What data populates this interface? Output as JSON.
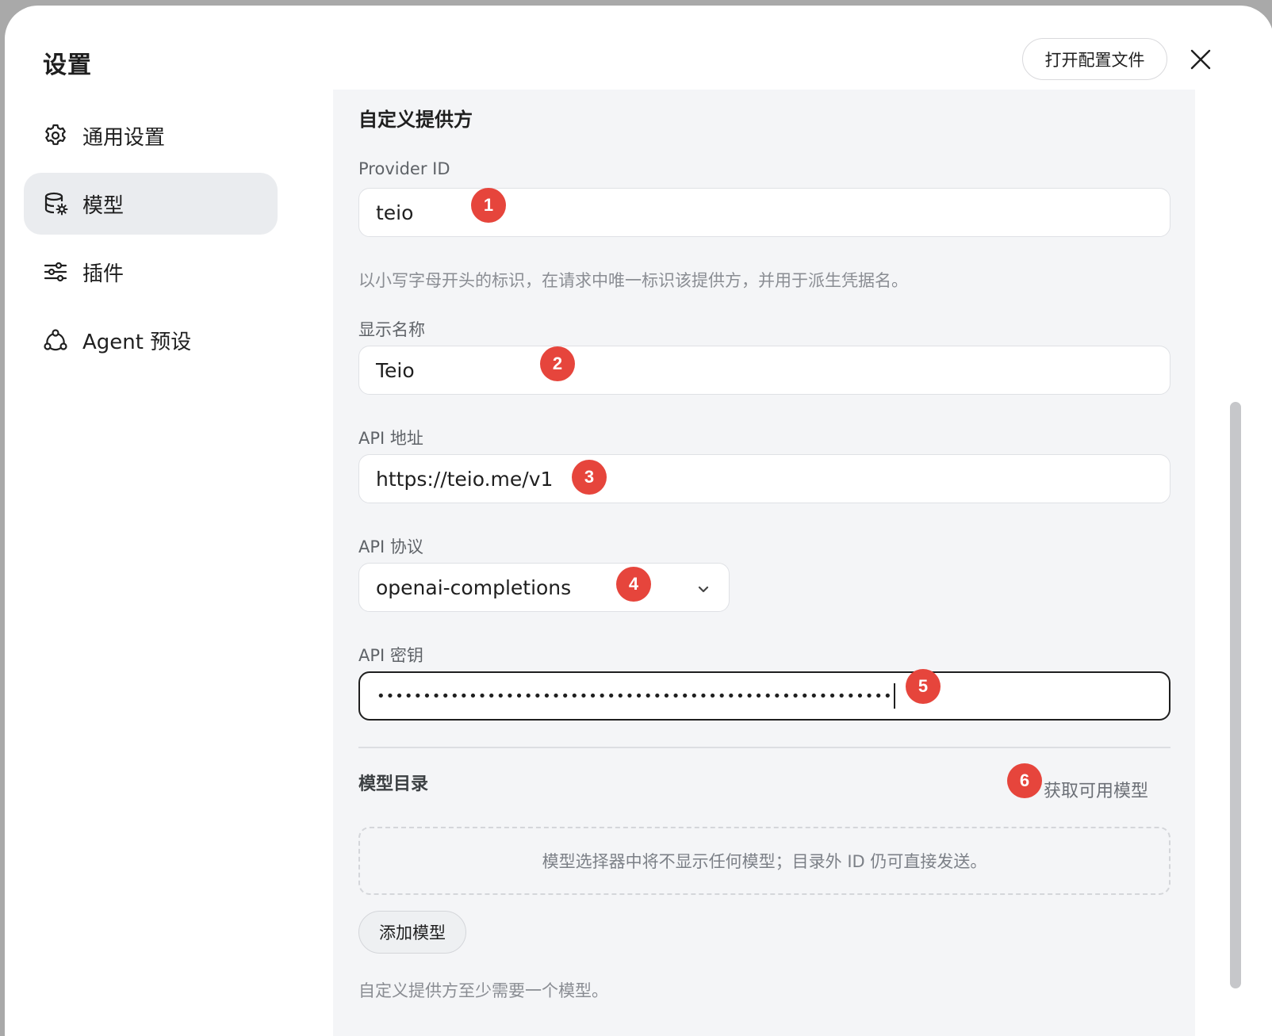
{
  "window": {
    "title": "设置",
    "open_config_label": "打开配置文件",
    "close_icon": "close-icon"
  },
  "sidebar": {
    "items": [
      {
        "label": "通用设置",
        "icon": "gear-icon",
        "active": false
      },
      {
        "label": "模型",
        "icon": "database-gear-icon",
        "active": true
      },
      {
        "label": "插件",
        "icon": "sliders-icon",
        "active": false
      },
      {
        "label": "Agent 预设",
        "icon": "agent-icon",
        "active": false
      }
    ]
  },
  "form": {
    "section_title": "自定义提供方",
    "provider_id": {
      "label": "Provider ID",
      "value": "teio",
      "hint": "以小写字母开头的标识，在请求中唯一标识该提供方，并用于派生凭据名。"
    },
    "display_name": {
      "label": "显示名称",
      "value": "Teio"
    },
    "api_url": {
      "label": "API 地址",
      "value": "https://teio.me/v1"
    },
    "api_protocol": {
      "label": "API 协议",
      "value": "openai-completions"
    },
    "api_key": {
      "label": "API 密钥",
      "masked_value": "••••••••••••••••••••••••••••••••••••••••••••••••••••••••"
    }
  },
  "catalog": {
    "heading": "模型目录",
    "fetch_label": "获取可用模型",
    "empty_text": "模型选择器中将不显示任何模型；目录外 ID 仍可直接发送。",
    "add_label": "添加模型",
    "requirement_hint": "自定义提供方至少需要一个模型。"
  },
  "annotations": [
    "1",
    "2",
    "3",
    "4",
    "5",
    "6"
  ],
  "colors": {
    "badge": "#e6453c",
    "panel_bg": "#f4f5f7",
    "active_nav": "#eaecef"
  }
}
